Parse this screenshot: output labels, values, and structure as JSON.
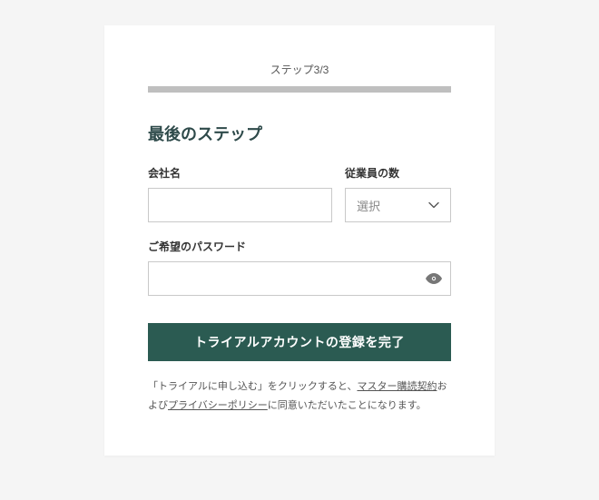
{
  "step": {
    "label": "ステップ3/3"
  },
  "heading": "最後のステップ",
  "fields": {
    "company": {
      "label": "会社名",
      "value": ""
    },
    "employees": {
      "label": "従業員の数",
      "placeholder": "選択"
    },
    "password": {
      "label": "ご希望のパスワード",
      "value": ""
    }
  },
  "submit": {
    "label": "トライアルアカウントの登録を完了"
  },
  "legal": {
    "prefix": "「トライアルに申し込む」をクリックすると、",
    "link1": "マスター購読契約",
    "mid": "および",
    "link2": "プライバシーポリシー",
    "suffix": "に同意いただいたことになります。"
  },
  "colors": {
    "accent": "#2b5b52"
  }
}
